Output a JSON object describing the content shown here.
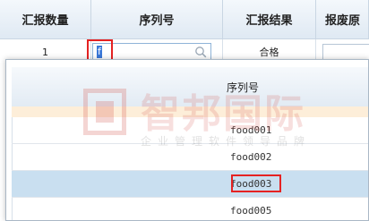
{
  "table": {
    "headers": [
      "汇报数量",
      "序列号",
      "汇报结果",
      "报废原"
    ],
    "row": {
      "quantity": "1",
      "serial_value": "f",
      "result": "合格"
    }
  },
  "dropdown": {
    "header": "序列号",
    "options": [
      "food001",
      "food002",
      "food003",
      "food005"
    ],
    "selected": "food003"
  },
  "watermark": {
    "title": "智邦国际",
    "subtitle": "企业管理软件领导品牌"
  },
  "colors": {
    "highlight": "#e52222",
    "selected_row": "#c9dff0",
    "accent_row": "#fdeed9"
  }
}
